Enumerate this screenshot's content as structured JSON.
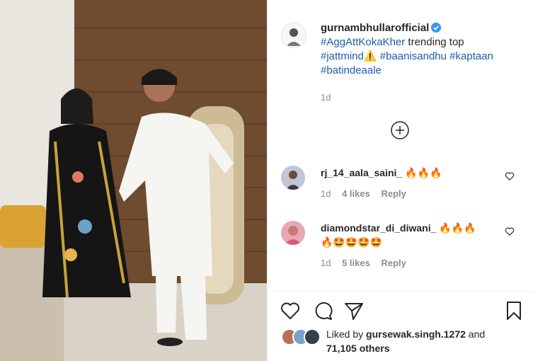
{
  "post": {
    "username": "gurnambhullarofficial",
    "caption_tag_1": "#AggAttKokaKher",
    "caption_text": "trending top",
    "caption_tag_2": "#jattmind",
    "caption_emoji": "⚠️",
    "caption_tag_3": "#baanisandhu",
    "caption_tag_4": "#kaptaan",
    "caption_tag_5": "#batindeaale",
    "time": "1d"
  },
  "comments": [
    {
      "username": "rj_14_aala_saini_",
      "text": "🔥🔥🔥",
      "time": "1d",
      "likes": "4 likes",
      "reply": "Reply"
    },
    {
      "username": "diamondstar_di_diwani_",
      "text": "🔥🔥🔥",
      "text2": "🔥🤩🤩🤩🤩",
      "time": "1d",
      "likes": "5 likes",
      "reply": "Reply"
    }
  ],
  "likes": {
    "prefix": "Liked by",
    "user": "gursewak.singh.1272",
    "and": "and",
    "others": "71,105 others"
  },
  "icons": [
    "verified-icon",
    "add-comment-icon",
    "heart-icon",
    "comment-icon",
    "share-icon",
    "bookmark-icon"
  ],
  "colors": {
    "link": "#1a5ea8",
    "verified": "#3897f0",
    "muted": "#8e8e8e"
  }
}
